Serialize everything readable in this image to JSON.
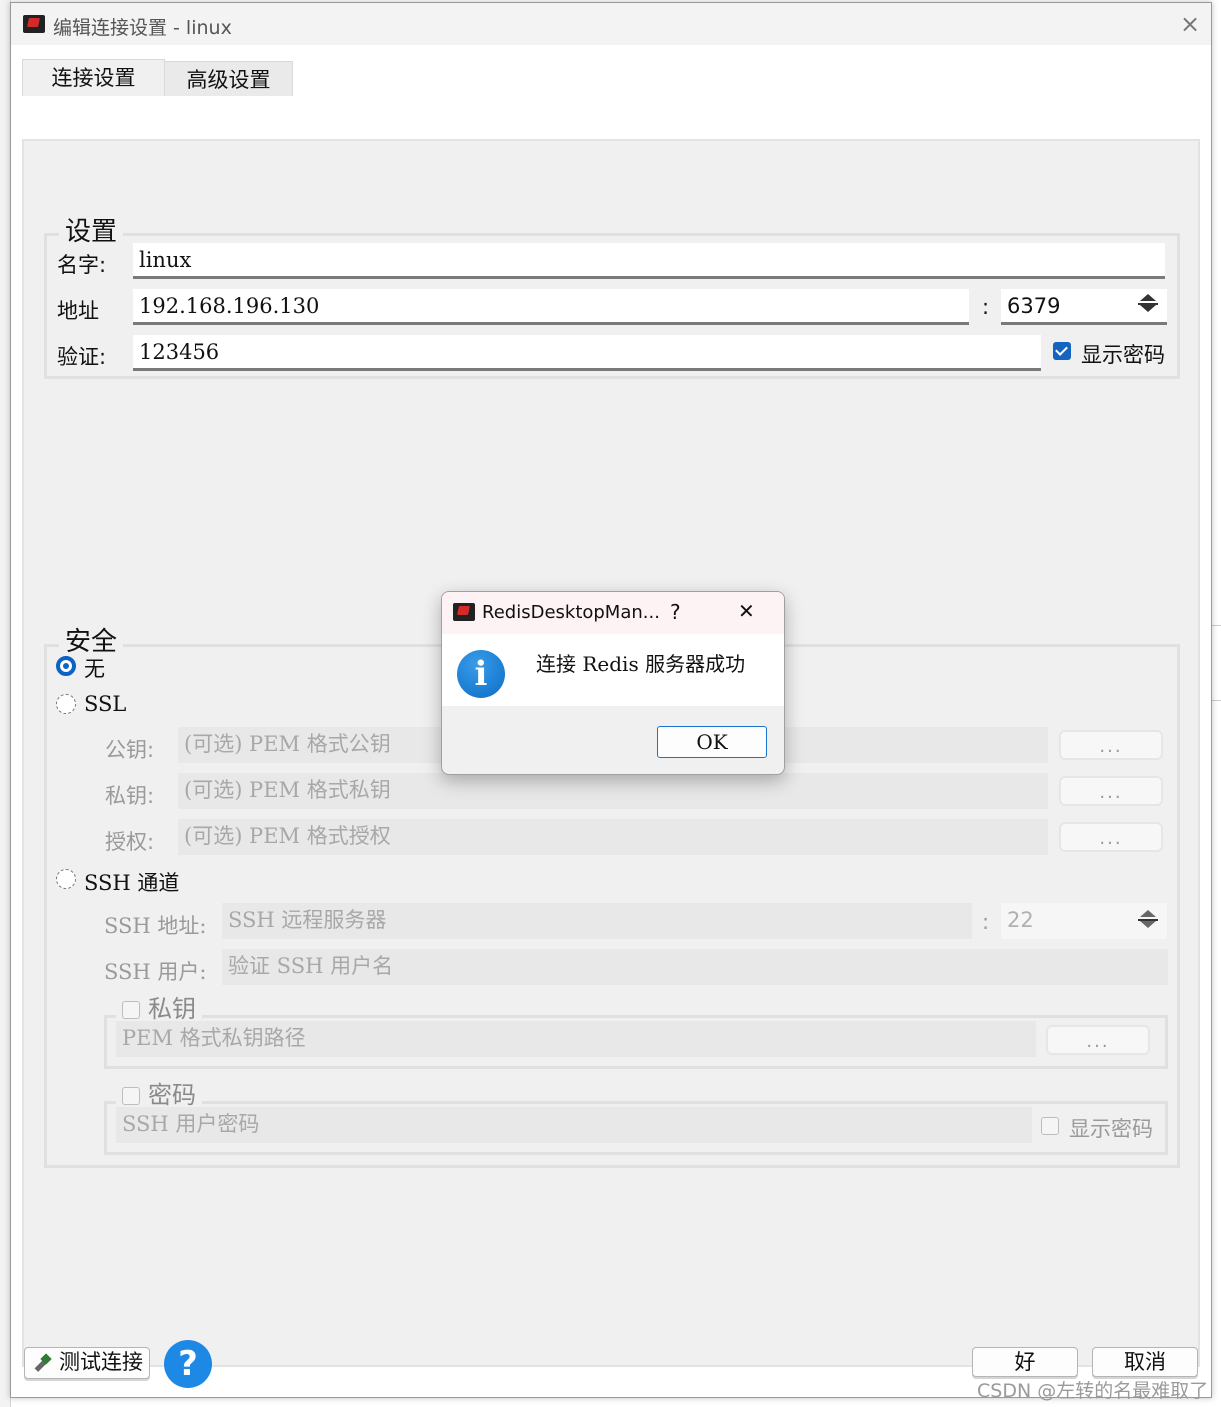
{
  "window": {
    "title": "编辑连接设置 - linux",
    "close_glyph": "×"
  },
  "tabs": [
    {
      "label": "连接设置"
    },
    {
      "label": "高级设置"
    }
  ],
  "settings_group": {
    "legend": "设置",
    "name_label": "名字:",
    "name_value": "linux",
    "address_label": "地址",
    "address_value": "192.168.196.130",
    "port_separator": ":",
    "port_value": "6379",
    "auth_label": "验证:",
    "auth_value": "123456",
    "show_password_label": "显示密码",
    "show_password_checked": true
  },
  "security_group": {
    "legend": "安全",
    "none_label": "无",
    "ssl_label": "SSL",
    "public_key_label": "公钥:",
    "public_key_placeholder": "(可选) PEM 格式公钥",
    "private_key_label": "私钥:",
    "private_key_placeholder": "(可选) PEM 格式私钥",
    "authority_label": "授权:",
    "authority_placeholder": "(可选) PEM 格式授权",
    "browse_label": "...",
    "ssh_label": "SSH 通道",
    "ssh_address_label": "SSH 地址:",
    "ssh_address_placeholder": "SSH 远程服务器",
    "ssh_port_separator": ":",
    "ssh_port_value": "22",
    "ssh_user_label": "SSH 用户:",
    "ssh_user_placeholder": "验证 SSH 用户名",
    "private_key_group_label": "私钥",
    "pem_path_placeholder": "PEM 格式私钥路径",
    "password_group_label": "密码",
    "ssh_password_placeholder": "SSH 用户密码",
    "ssh_show_password_label": "显示密码"
  },
  "footer": {
    "test_connection_label": "测试连接",
    "help_glyph": "?",
    "ok_label": "好",
    "cancel_label": "取消"
  },
  "message_box": {
    "title": "RedisDesktopMan...",
    "help_glyph": "?",
    "close_glyph": "✕",
    "info_glyph": "i",
    "message": "连接 Redis 服务器成功",
    "ok_label": "OK"
  },
  "watermark": "CSDN @左转的名最难取了",
  "colors": {
    "accent": "#1565c0",
    "info_icon": "#1e88e5",
    "dialog_bg": "#f0f0f0"
  }
}
